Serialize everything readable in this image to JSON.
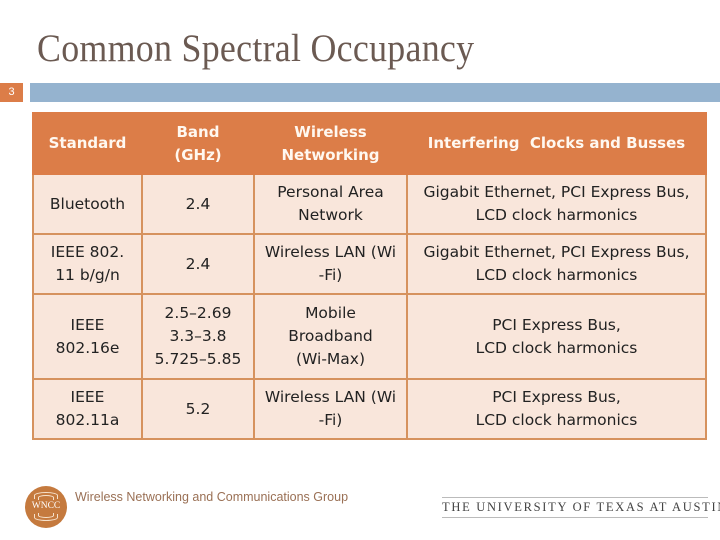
{
  "slide": {
    "title": "Common Spectral Occupancy",
    "number": "3"
  },
  "colors": {
    "accent_orange": "#dc7d48",
    "header_bar_blue": "#95b3cf",
    "cell_fill": "#f9e6db",
    "title_text": "#6b5a52"
  },
  "table": {
    "headers": [
      "Standard",
      "Band (GHz)",
      "Wireless Networking",
      "Interfering  Clocks and Busses"
    ],
    "rows": [
      [
        "Bluetooth",
        "2.4",
        "Personal Area Network",
        "Gigabit Ethernet, PCI Express Bus, LCD clock harmonics"
      ],
      [
        "IEEE 802. 11 b/g/n",
        "2.4",
        "Wireless LAN (Wi -Fi)",
        "Gigabit Ethernet, PCI Express Bus, LCD clock harmonics"
      ],
      [
        "IEEE 802.16e",
        "2.5–2.69 3.3–3.8 5.725–5.85",
        "Mobile Broadband (Wi-Max)",
        "PCI Express Bus, LCD clock harmonics"
      ],
      [
        "IEEE 802.11a",
        "5.2",
        "Wireless LAN (Wi -Fi)",
        "PCI Express Bus, LCD clock harmonics"
      ]
    ],
    "display": {
      "h0": "Standard",
      "h1a": "Band",
      "h1b": "(GHz)",
      "h2a": "Wireless",
      "h2b": "Networking",
      "h3": "Interfering  Clocks and Busses",
      "r0": {
        "c0": "Bluetooth",
        "c1": "2.4",
        "c2a": "Personal Area",
        "c2b": "Network",
        "c3a": "Gigabit Ethernet, PCI Express Bus,",
        "c3b": "LCD clock harmonics"
      },
      "r1": {
        "c0a": "IEEE 802.",
        "c0b": "11 b/g/n",
        "c1": "2.4",
        "c2a": "Wireless LAN (Wi",
        "c2b": "-Fi)",
        "c3a": "Gigabit Ethernet, PCI Express Bus,",
        "c3b": "LCD clock harmonics"
      },
      "r2": {
        "c0a": "IEEE",
        "c0b": "802.16e",
        "c1a": "2.5–2.69",
        "c1b": "3.3–3.8",
        "c1c": "5.725–5.85",
        "c2a": "Mobile",
        "c2b": "Broadband",
        "c2c": "(Wi-Max)",
        "c3a": "PCI Express Bus,",
        "c3b": "LCD clock harmonics"
      },
      "r3": {
        "c0a": "IEEE",
        "c0b": "802.11a",
        "c1": "5.2",
        "c2a": "Wireless LAN (Wi",
        "c2b": "-Fi)",
        "c3a": "PCI Express Bus,",
        "c3b": "LCD clock harmonics"
      }
    }
  },
  "footer": {
    "logo_text": "WNCC",
    "group_name": "Wireless Networking and Communications Group",
    "university": "THE UNIVERSITY OF TEXAS AT AUSTIN"
  }
}
